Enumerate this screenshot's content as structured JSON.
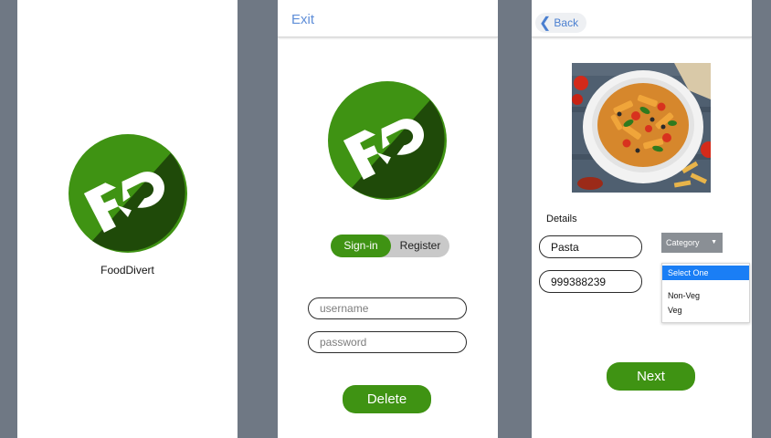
{
  "colors": {
    "background": "#6f7884",
    "brand_green": "#3f9313",
    "logo_dark_green": "#1f4a09",
    "link_blue": "#5f8ed8",
    "highlight_blue": "#1a7ef5"
  },
  "splash": {
    "logo_icon": "fooddivert-logo-icon",
    "app_name": "FoodDivert"
  },
  "login": {
    "exit_label": "Exit",
    "logo_icon": "fooddivert-logo-icon",
    "toggle": {
      "signin_label": "Sign-in",
      "register_label": "Register",
      "selected": "Sign-in"
    },
    "username": {
      "value": "",
      "placeholder": "username"
    },
    "password": {
      "value": "",
      "placeholder": "password"
    },
    "delete_label": "Delete"
  },
  "details": {
    "back_icon": "chevron-left-icon",
    "back_label": "Back",
    "image_icon": "pasta-dish-image",
    "section_label": "Details",
    "name_value": "Pasta",
    "phone_value": "999388239",
    "category": {
      "label": "Category",
      "arrow_icon": "caret-down-icon",
      "options": [
        "Select One",
        "Non-Veg",
        "Veg"
      ],
      "highlighted": "Select One"
    },
    "next_label": "Next"
  }
}
